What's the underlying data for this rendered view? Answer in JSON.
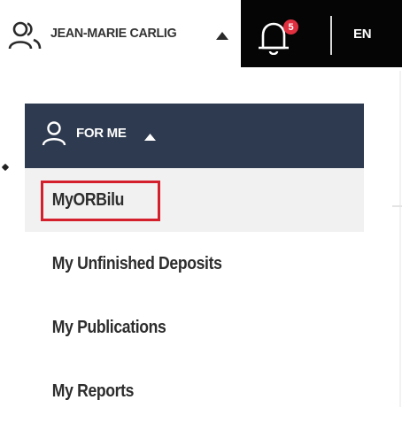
{
  "user": {
    "name": "JEAN-MARIE CARLIG"
  },
  "notifications": {
    "count": "5"
  },
  "language": {
    "current": "EN"
  },
  "panel": {
    "title": "FOR ME"
  },
  "menu": {
    "items": [
      {
        "label": "MyORBilu"
      },
      {
        "label": "My Unfinished Deposits"
      },
      {
        "label": "My Publications"
      },
      {
        "label": "My Reports"
      }
    ]
  },
  "colors": {
    "panel_header_bg": "#2e3a4f",
    "topbar_dark": "#050505",
    "badge": "#e03040",
    "highlight": "#d41f2d",
    "active_item_bg": "#f1f1f1"
  },
  "icons": [
    "user-icon",
    "caret-up-icon",
    "bell-icon"
  ]
}
